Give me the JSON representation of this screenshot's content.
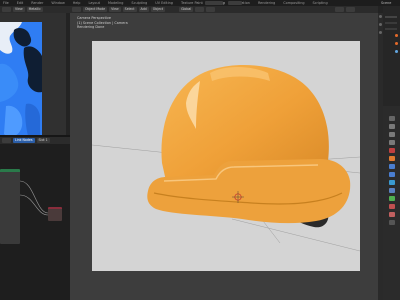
{
  "topbar": {
    "menus": [
      "File",
      "Edit",
      "Render",
      "Window",
      "Help",
      "Layout",
      "Modeling",
      "Sculpting",
      "UV Editing",
      "Texture Paint",
      "Shading",
      "Animation",
      "Rendering",
      "Compositing",
      "Scripting"
    ],
    "active_tab": "Shading",
    "scene_label": "Scene"
  },
  "image_editor": {
    "mode_label": "View",
    "image_name": "Metallic"
  },
  "node_editor": {
    "header_label": "Link Nodes",
    "slot_label": "Slot 1"
  },
  "viewport": {
    "header": {
      "object_mode": "Object Mode",
      "view": "View",
      "select": "Select",
      "add": "Add",
      "object": "Object",
      "global": "Global"
    },
    "camera_info": {
      "line1": "Camera Perspective",
      "line2": "(1) Scene Collection | Camera",
      "line3": "Rendering Done"
    }
  },
  "colors": {
    "helmet": "#f0a33c",
    "uv_blue": "#2f7df3",
    "accent_blue": "#2b5ea8"
  }
}
